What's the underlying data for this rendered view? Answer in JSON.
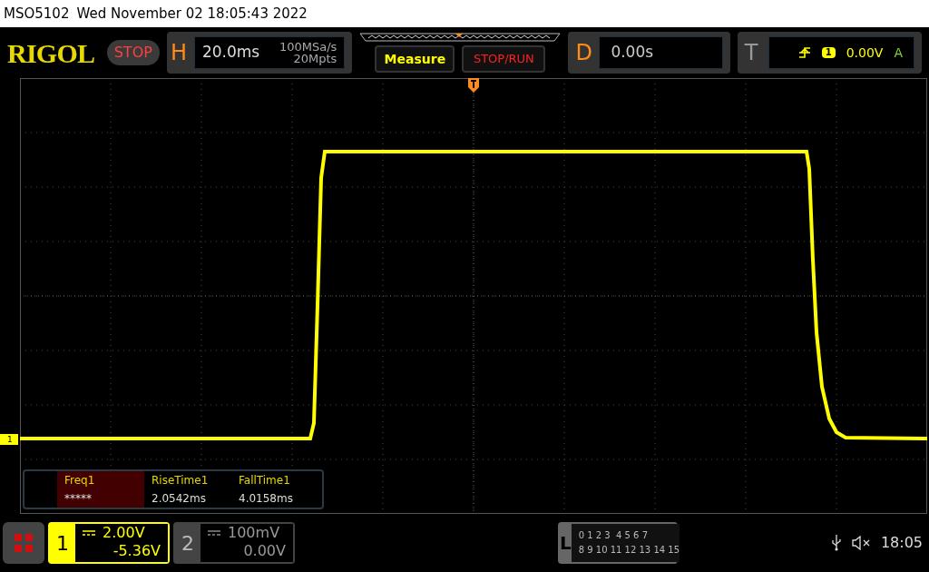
{
  "title_bar": {
    "model": "MSO5102",
    "datetime": "Wed November 02 18:05:43 2022"
  },
  "header": {
    "logo": "RIGOL",
    "run_state": "STOP",
    "horizontal": {
      "label": "H",
      "timebase": "20.0ms",
      "sample_rate": "100MSa/s",
      "memory_depth": "20Mpts"
    },
    "measure_button": "Measure",
    "stop_run_button": "STOP/RUN",
    "delay": {
      "label": "D",
      "value": "0.00s"
    },
    "trigger": {
      "label": "T",
      "source": "1",
      "level": "0.00V",
      "mode": "A"
    }
  },
  "channel_marker": "1",
  "measurements": [
    {
      "name": "Freq1",
      "value": "*****",
      "selected": true
    },
    {
      "name": "RiseTime1",
      "value": "2.0542ms",
      "selected": false
    },
    {
      "name": "FallTime1",
      "value": "4.0158ms",
      "selected": false
    }
  ],
  "channels": [
    {
      "number": "1",
      "scale": "2.00V",
      "offset": "-5.36V",
      "on": true
    },
    {
      "number": "2",
      "scale": "100mV",
      "offset": "0.00V",
      "on": false
    }
  ],
  "logic": {
    "label": "L",
    "rows": [
      "0 1 2 3  4 5 6 7",
      "8 9 10 11 12 13 14 15"
    ]
  },
  "status": {
    "time": "18:05"
  }
}
